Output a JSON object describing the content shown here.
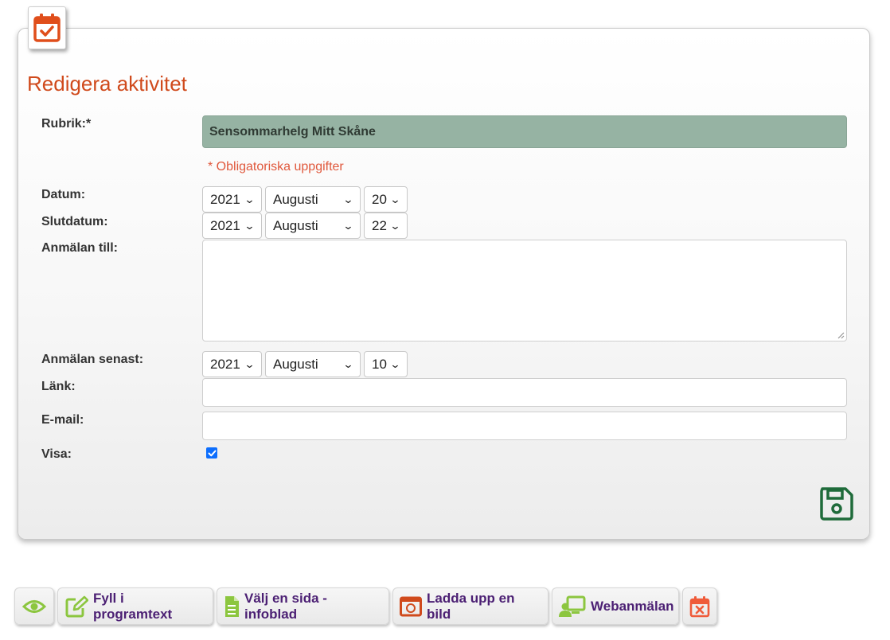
{
  "page": {
    "title": "Redigera aktivitet",
    "required_note": "* Obligatoriska uppgifter"
  },
  "form": {
    "rubrik": {
      "label": "Rubrik:*",
      "value": "Sensommarhelg Mitt Skåne"
    },
    "datum": {
      "label": "Datum:",
      "year": "2021",
      "month": "Augusti",
      "day": "20"
    },
    "slutdatum": {
      "label": "Slutdatum:",
      "year": "2021",
      "month": "Augusti",
      "day": "22"
    },
    "anmalan_till": {
      "label": "Anmälan till:",
      "value": ""
    },
    "anmalan_senast": {
      "label": "Anmälan senast:",
      "year": "2021",
      "month": "Augusti",
      "day": "10"
    },
    "lank": {
      "label": "Länk:",
      "value": ""
    },
    "email": {
      "label": "E-mail:",
      "value": ""
    },
    "visa": {
      "label": "Visa:",
      "checked": true
    }
  },
  "icons": {
    "badge": "calendar-check-icon",
    "save": "floppy-disk-icon",
    "chevron": "chevron-down-icon"
  },
  "toolbar": {
    "preview_icon": "eye-icon",
    "fill_program": "Fyll i programtext",
    "choose_page": "Välj en sida - infoblad",
    "upload_image": "Ladda upp en bild",
    "web_signup": "Webanmälan",
    "delete_icon": "calendar-x-icon"
  },
  "colors": {
    "title": "#d04a1c",
    "accent_green": "#1f6b3a",
    "lime": "#8cc63f",
    "toolbar_text": "#4b1f73",
    "required": "#e0583c"
  }
}
